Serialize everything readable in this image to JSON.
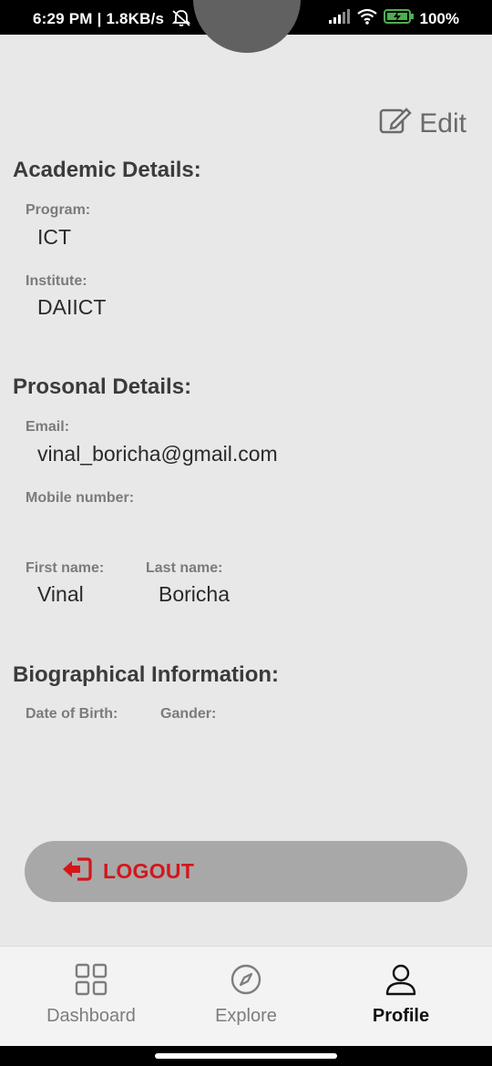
{
  "status_bar": {
    "time": "6:29 PM | 1.8KB/s",
    "battery": "100%",
    "icons": [
      "mute-bell-icon",
      "signal-icon",
      "wifi-icon",
      "battery-charging-icon"
    ]
  },
  "edit": {
    "label": "Edit",
    "icon": "edit-icon"
  },
  "academic": {
    "title": "Academic Details:",
    "program_label": "Program:",
    "program_value": "ICT",
    "institute_label": "Institute:",
    "institute_value": "DAIICT"
  },
  "personal": {
    "title": "Prosonal Details:",
    "email_label": "Email:",
    "email_value": "vinal_boricha@gmail.com",
    "mobile_label": "Mobile number:",
    "mobile_value": "",
    "first_name_label": "First name:",
    "first_name_value": "Vinal",
    "last_name_label": "Last name:",
    "last_name_value": "Boricha"
  },
  "bio": {
    "title": "Biographical Information:",
    "dob_label": "Date of Birth:",
    "dob_value": "",
    "gender_label": "Gander:",
    "gender_value": ""
  },
  "logout": {
    "label": "LOGOUT",
    "icon": "logout-icon",
    "color": "#d3161a"
  },
  "nav": {
    "items": [
      {
        "label": "Dashboard",
        "icon": "grid-icon"
      },
      {
        "label": "Explore",
        "icon": "compass-icon"
      },
      {
        "label": "Profile",
        "icon": "user-icon"
      }
    ],
    "active": "Profile"
  }
}
